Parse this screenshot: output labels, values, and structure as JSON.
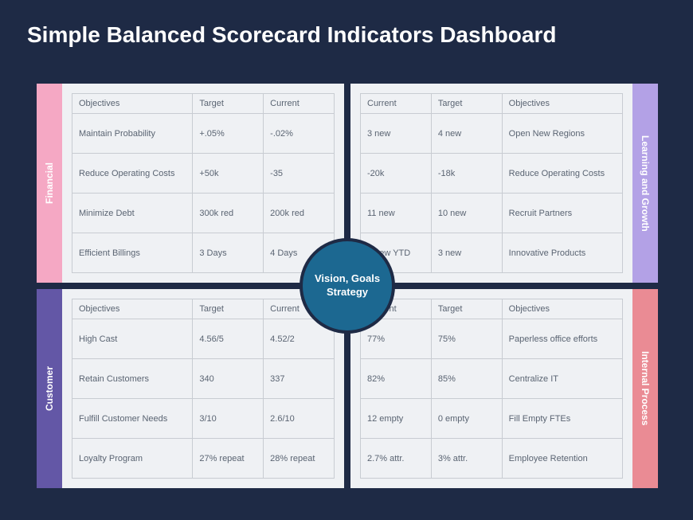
{
  "title": "Simple Balanced Scorecard Indicators Dashboard",
  "center": "Vision, Goals Strategy",
  "quads": {
    "financial": {
      "label": "Financial",
      "headers": [
        "Objectives",
        "Target",
        "Current"
      ],
      "rows": [
        [
          "Maintain Probability",
          "+.05%",
          "-.02%"
        ],
        [
          "Reduce Operating Costs",
          "+50k",
          "-35"
        ],
        [
          "Minimize Debt",
          "300k red",
          "200k red"
        ],
        [
          "Efficient Billings",
          "3 Days",
          "4 Days"
        ]
      ]
    },
    "learning": {
      "label": "Learning and Growth",
      "headers": [
        "Current",
        "Target",
        "Objectives"
      ],
      "rows": [
        [
          "3 new",
          "4 new",
          "Open New Regions"
        ],
        [
          "-20k",
          "-18k",
          "Reduce Operating Costs"
        ],
        [
          "11 new",
          "10 new",
          "Recruit Partners"
        ],
        [
          "0 new YTD",
          "3 new",
          "Innovative Products"
        ]
      ]
    },
    "customer": {
      "label": "Customer",
      "headers": [
        "Objectives",
        "Target",
        "Current"
      ],
      "rows": [
        [
          "High Cast",
          "4.56/5",
          "4.52/2"
        ],
        [
          "Retain Customers",
          "340",
          "337"
        ],
        [
          "Fulfill Customer Needs",
          "3/10",
          "2.6/10"
        ],
        [
          "Loyalty Program",
          "27% repeat",
          "28% repeat"
        ]
      ]
    },
    "internal": {
      "label": "Internal Process",
      "headers": [
        "Current",
        "Target",
        "Objectives"
      ],
      "rows": [
        [
          "77%",
          "75%",
          "Paperless office efforts"
        ],
        [
          "82%",
          "85%",
          "Centralize IT"
        ],
        [
          "12 empty",
          "0 empty",
          "Fill Empty FTEs"
        ],
        [
          "2.7% attr.",
          "3% attr.",
          "Employee Retention"
        ]
      ]
    }
  }
}
